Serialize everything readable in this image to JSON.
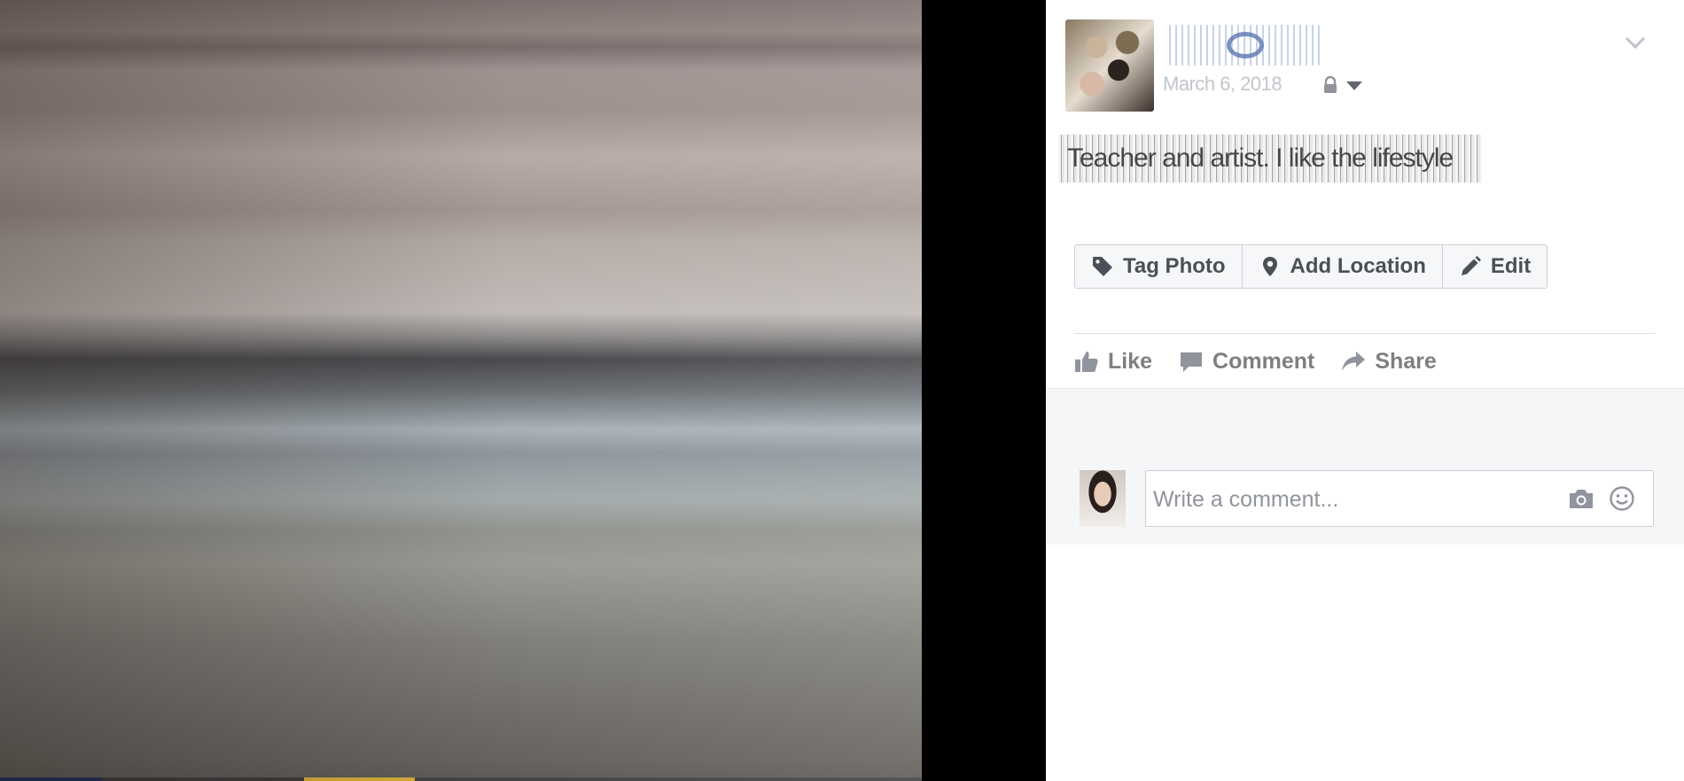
{
  "post": {
    "author_name": "",
    "date": "March 6, 2018",
    "caption": "Teacher and artist. I like the lifestyle"
  },
  "actions": {
    "tag_photo": "Tag Photo",
    "add_location": "Add Location",
    "edit": "Edit"
  },
  "reactions": {
    "like": "Like",
    "comment": "Comment",
    "share": "Share"
  },
  "comment_box": {
    "placeholder": "Write a comment..."
  },
  "icons": [
    "lock-icon",
    "audience-caret-icon",
    "chevron-down-icon",
    "tag-icon",
    "location-pin-icon",
    "pencil-icon",
    "thumbs-up-icon",
    "comment-bubble-icon",
    "share-arrow-icon",
    "camera-icon",
    "emoji-icon"
  ],
  "colors": {
    "panel_background": "#ffffff",
    "comments_background": "#f5f6f7",
    "button_text": "#4b4f56",
    "reaction_text": "#7f7f7f",
    "border": "#ccd0d5"
  }
}
